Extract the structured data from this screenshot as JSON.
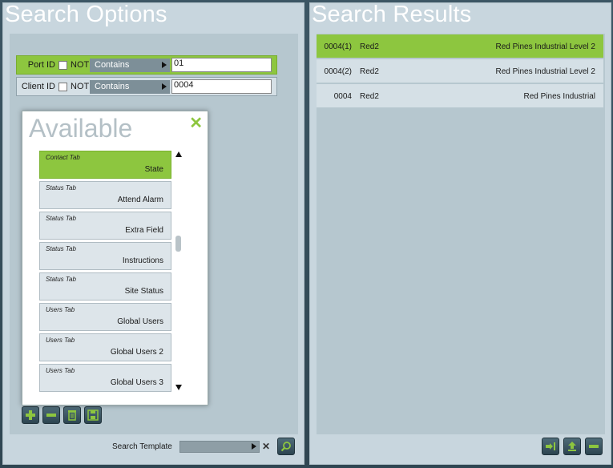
{
  "search_options": {
    "title": "Search Options",
    "criteria": [
      {
        "label": "Port ID",
        "not_label": "NOT",
        "operator": "Contains",
        "value": "01",
        "active": true
      },
      {
        "label": "Client ID",
        "not_label": "NOT",
        "operator": "Contains",
        "value": "0004",
        "active": false
      }
    ],
    "available": {
      "title": "Available",
      "close_glyph": "✕",
      "items": [
        {
          "tab": "Contact Tab",
          "name": "State",
          "selected": true
        },
        {
          "tab": "Status Tab",
          "name": "Attend Alarm"
        },
        {
          "tab": "Status Tab",
          "name": "Extra Field"
        },
        {
          "tab": "Status Tab",
          "name": "Instructions"
        },
        {
          "tab": "Status Tab",
          "name": "Site Status"
        },
        {
          "tab": "Users Tab",
          "name": "Global Users"
        },
        {
          "tab": "Users Tab",
          "name": "Global Users 2"
        },
        {
          "tab": "Users Tab",
          "name": "Global Users 3"
        }
      ]
    },
    "toolbar_icons": [
      "plus-icon",
      "minus-icon",
      "trash-icon",
      "save-icon"
    ],
    "template": {
      "label": "Search Template",
      "value": "",
      "clear_glyph": "✕"
    },
    "search_icon": "search-icon"
  },
  "search_results": {
    "title": "Search Results",
    "rows": [
      {
        "id": "0004(1)",
        "code": "Red2",
        "name": "Red Pines Industrial Level 2",
        "selected": true
      },
      {
        "id": "0004(2)",
        "code": "Red2",
        "name": "Red Pines Industrial Level 2"
      },
      {
        "id": "0004",
        "code": "Red2",
        "name": "Red Pines Industrial"
      }
    ],
    "toolbar_icons": [
      "export-icon",
      "upload-icon",
      "remove-icon"
    ]
  },
  "colors": {
    "accent": "#8dc63f",
    "panel": "#c8d6de",
    "background": "#3c5664"
  }
}
